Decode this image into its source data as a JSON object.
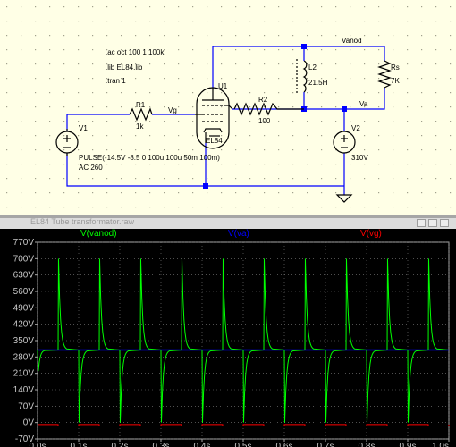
{
  "schematic": {
    "directives": [
      ".ac oct 100 1 100k",
      ".lib EL84.lib",
      ".tran 1"
    ],
    "v1_name": "V1",
    "v1_value_lines": [
      "PULSE(-14.5V -8.5 0 100u 100u 50m 100m)",
      "AC 260"
    ],
    "r1_name": "R1",
    "r1_value": "1k",
    "net_vg": "Vg",
    "u1_name": "U1",
    "u1_value": "EL84",
    "r2_name": "R2",
    "r2_value": "100",
    "l2_name": "L2",
    "l2_value": "21.5H",
    "rs_name": "Rs",
    "rs_value": "7K",
    "net_vanod": "Vanod",
    "net_va": "Va",
    "v2_name": "V2",
    "v2_value": "310V"
  },
  "plot_window": {
    "title": "EL84 Tube transformator.raw"
  },
  "colors": {
    "vanod": "#00ff00",
    "va": "#0000ff",
    "vg": "#ff0000",
    "schematic_wire": "#0000ff",
    "schematic_component": "#000000",
    "schematic_bg": "#ffffe6",
    "plot_bg": "#000000",
    "axis_text": "#c8c8c8",
    "grid": "#808080"
  },
  "chart_data": {
    "type": "line",
    "title": "",
    "xlabel": "",
    "ylabel": "",
    "xlim": [
      0,
      1.0
    ],
    "ylim": [
      -70,
      770
    ],
    "x_ticks": [
      "0.0s",
      "0.1s",
      "0.2s",
      "0.3s",
      "0.4s",
      "0.5s",
      "0.6s",
      "0.7s",
      "0.8s",
      "0.9s",
      "1.0s"
    ],
    "y_ticks": [
      "-70V",
      "0V",
      "70V",
      "140V",
      "210V",
      "280V",
      "350V",
      "420V",
      "490V",
      "560V",
      "630V",
      "700V",
      "770V"
    ],
    "grid": true,
    "pulse_period_s": 0.1,
    "pulse_width_s": 0.05,
    "series": [
      {
        "name": "V(vanod)",
        "color": "#00ff00",
        "baseline": 310,
        "spike_up_peak": 700,
        "spike_down_min": 0
      },
      {
        "name": "V(va)",
        "color": "#0000ff",
        "baseline": 310
      },
      {
        "name": "V(vg)",
        "color": "#ff0000",
        "high": -8.5,
        "low": -14.5
      }
    ]
  }
}
